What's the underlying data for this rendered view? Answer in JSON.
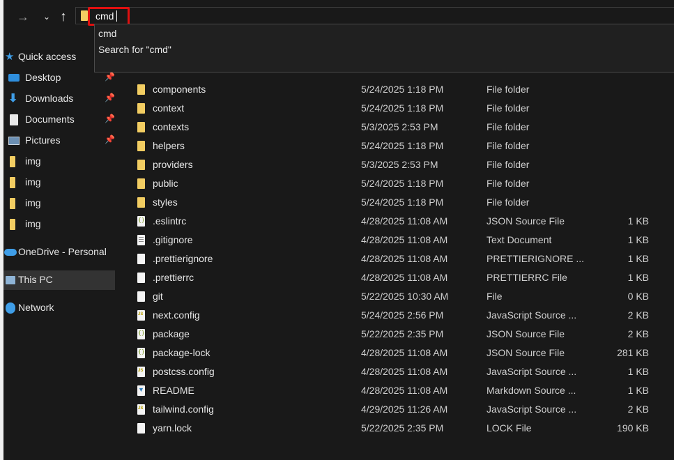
{
  "address_bar": {
    "text": "cmd",
    "suggestions": [
      "cmd",
      "Search for \"cmd\""
    ]
  },
  "sidebar": {
    "items": [
      {
        "label": "Quick access",
        "icon": "star-icon"
      },
      {
        "label": "Desktop",
        "icon": "desktop-icon",
        "pinned": true
      },
      {
        "label": "Downloads",
        "icon": "download-icon",
        "pinned": true
      },
      {
        "label": "Documents",
        "icon": "documents-icon",
        "pinned": true
      },
      {
        "label": "Pictures",
        "icon": "pictures-icon",
        "pinned": true
      },
      {
        "label": "img",
        "icon": "folder-icon"
      },
      {
        "label": "img",
        "icon": "folder-icon"
      },
      {
        "label": "img",
        "icon": "folder-icon"
      },
      {
        "label": "img",
        "icon": "folder-icon"
      },
      {
        "label": "OneDrive - Personal",
        "icon": "cloud-icon"
      },
      {
        "label": "This PC",
        "icon": "computer-icon",
        "selected": true
      },
      {
        "label": "Network",
        "icon": "network-icon"
      }
    ]
  },
  "files": [
    {
      "name": "components",
      "date": "5/24/2025 1:18 PM",
      "type": "File folder",
      "size": "",
      "icon": "folder-icon"
    },
    {
      "name": "context",
      "date": "5/24/2025 1:18 PM",
      "type": "File folder",
      "size": "",
      "icon": "folder-icon"
    },
    {
      "name": "contexts",
      "date": "5/3/2025 2:53 PM",
      "type": "File folder",
      "size": "",
      "icon": "folder-icon"
    },
    {
      "name": "helpers",
      "date": "5/24/2025 1:18 PM",
      "type": "File folder",
      "size": "",
      "icon": "folder-icon"
    },
    {
      "name": "providers",
      "date": "5/3/2025 2:53 PM",
      "type": "File folder",
      "size": "",
      "icon": "folder-icon"
    },
    {
      "name": "public",
      "date": "5/24/2025 1:18 PM",
      "type": "File folder",
      "size": "",
      "icon": "folder-icon"
    },
    {
      "name": "styles",
      "date": "5/24/2025 1:18 PM",
      "type": "File folder",
      "size": "",
      "icon": "folder-icon"
    },
    {
      "name": ".eslintrc",
      "date": "4/28/2025 11:08 AM",
      "type": "JSON Source File",
      "size": "1 KB",
      "icon": "json-file-icon"
    },
    {
      "name": ".gitignore",
      "date": "4/28/2025 11:08 AM",
      "type": "Text Document",
      "size": "1 KB",
      "icon": "text-file-icon"
    },
    {
      "name": ".prettierignore",
      "date": "4/28/2025 11:08 AM",
      "type": "PRETTIERIGNORE ...",
      "size": "1 KB",
      "icon": "file-icon"
    },
    {
      "name": ".prettierrc",
      "date": "4/28/2025 11:08 AM",
      "type": "PRETTIERRC File",
      "size": "1 KB",
      "icon": "file-icon"
    },
    {
      "name": "git",
      "date": "5/22/2025 10:30 AM",
      "type": "File",
      "size": "0 KB",
      "icon": "file-icon"
    },
    {
      "name": "next.config",
      "date": "5/24/2025 2:56 PM",
      "type": "JavaScript Source ...",
      "size": "2 KB",
      "icon": "js-file-icon"
    },
    {
      "name": "package",
      "date": "5/22/2025 2:35 PM",
      "type": "JSON Source File",
      "size": "2 KB",
      "icon": "json-file-icon"
    },
    {
      "name": "package-lock",
      "date": "4/28/2025 11:08 AM",
      "type": "JSON Source File",
      "size": "281 KB",
      "icon": "json-file-icon"
    },
    {
      "name": "postcss.config",
      "date": "4/28/2025 11:08 AM",
      "type": "JavaScript Source ...",
      "size": "1 KB",
      "icon": "js-file-icon"
    },
    {
      "name": "README",
      "date": "4/28/2025 11:08 AM",
      "type": "Markdown Source ...",
      "size": "1 KB",
      "icon": "markdown-file-icon"
    },
    {
      "name": "tailwind.config",
      "date": "4/29/2025 11:26 AM",
      "type": "JavaScript Source ...",
      "size": "2 KB",
      "icon": "js-file-icon"
    },
    {
      "name": "yarn.lock",
      "date": "5/22/2025 2:35 PM",
      "type": "LOCK File",
      "size": "190 KB",
      "icon": "file-icon"
    }
  ]
}
